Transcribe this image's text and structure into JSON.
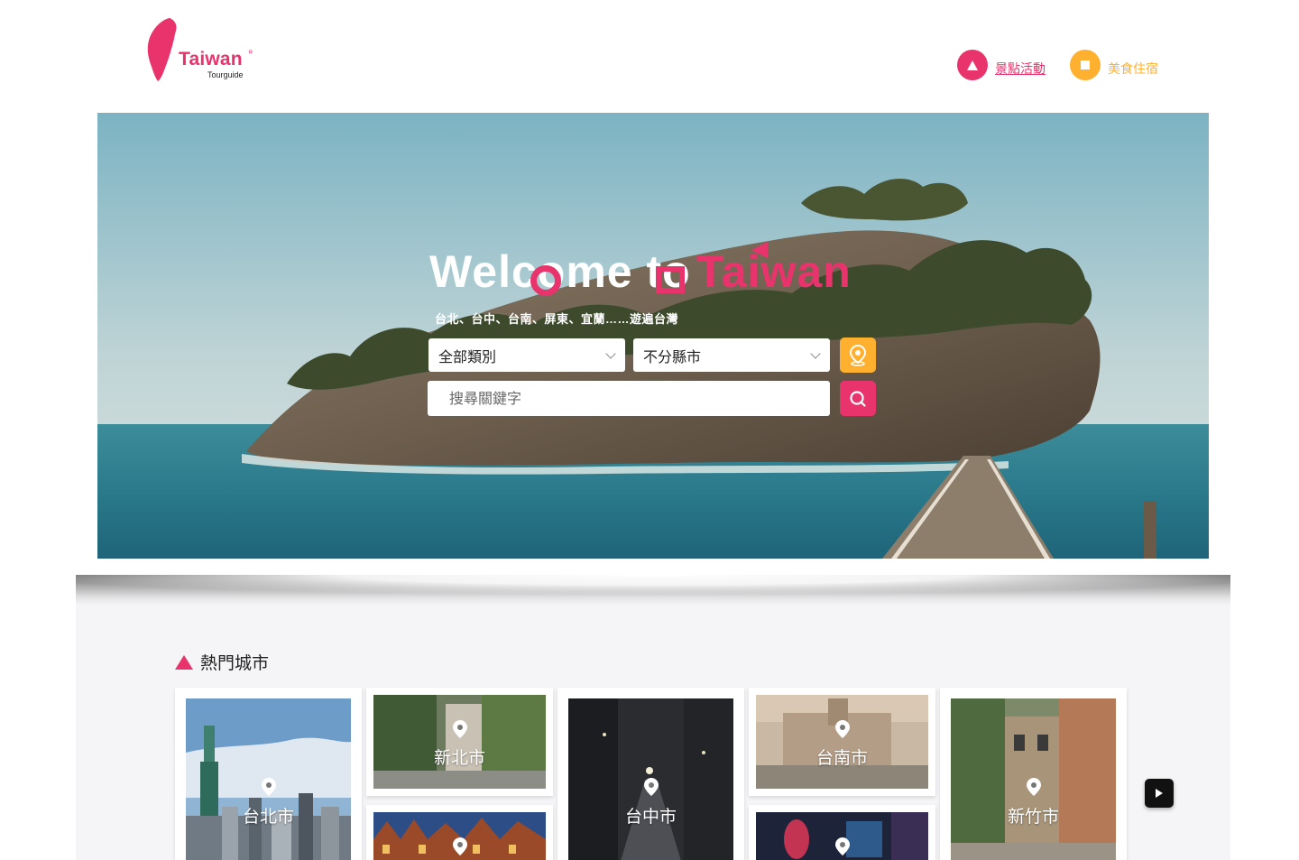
{
  "brand": {
    "name": "Taiwan",
    "degree": "°",
    "subtitle": "Tourguide",
    "primary_color": "#e8336d",
    "accent_color": "#ffb02e"
  },
  "nav": {
    "spots_label": "景點活動",
    "spots_icon": "triangle-icon",
    "food_label": "美食住宿",
    "food_icon": "square-icon"
  },
  "hero": {
    "welcome_prefix": "Welcome to",
    "welcome_highlight": "Taiwan",
    "tagline": "台北、台中、台南、屏東、宜蘭……遊遍台灣",
    "category_select": "全部類別",
    "city_select": "不分縣市",
    "search_placeholder": "搜尋關鍵字",
    "locate_icon": "location-pin-icon",
    "search_icon": "search-icon"
  },
  "popular": {
    "title": "熱門城市",
    "cities": [
      {
        "name": "台北市"
      },
      {
        "name": "新北市"
      },
      {
        "name": ""
      },
      {
        "name": "台中市"
      },
      {
        "name": "台南市"
      },
      {
        "name": ""
      },
      {
        "name": "新竹市"
      }
    ],
    "next_icon": "play-arrow-icon"
  }
}
